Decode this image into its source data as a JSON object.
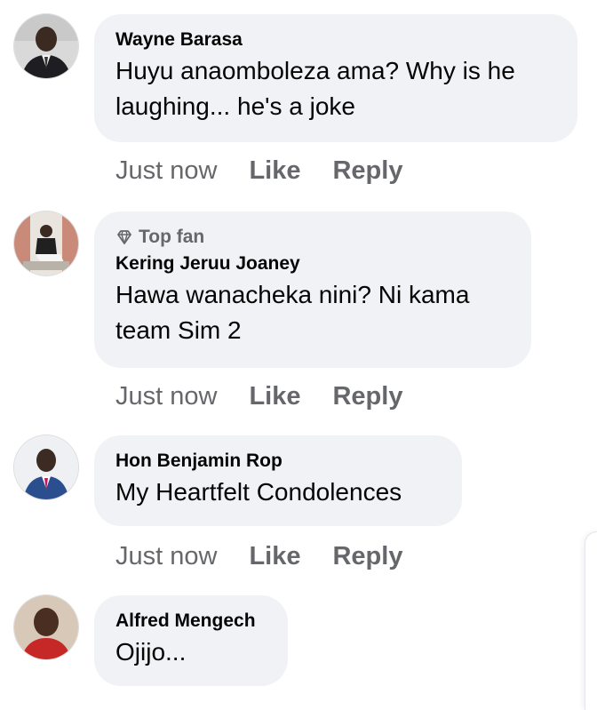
{
  "comments": [
    {
      "author": "Wayne Barasa",
      "badge": "",
      "text_lines": [
        "Huyu anaomboleza ama? Why is he",
        "laughing... he's a joke"
      ],
      "time": "Just now",
      "like_label": "Like",
      "reply_label": "Reply"
    },
    {
      "author": "Kering Jeruu Joaney",
      "badge": "Top fan",
      "badge_icon": "diamond-icon",
      "text_lines": [
        "Hawa wanacheka nini? Ni kama",
        "team Sim 2"
      ],
      "time": "Just now",
      "like_label": "Like",
      "reply_label": "Reply"
    },
    {
      "author": "Hon Benjamin Rop",
      "badge": "",
      "text_lines": [
        "My Heartfelt Condolences"
      ],
      "time": "Just now",
      "like_label": "Like",
      "reply_label": "Reply"
    },
    {
      "author": "Alfred Mengech",
      "badge": "",
      "text_lines": [
        "Ojijo..."
      ],
      "time": "",
      "like_label": "",
      "reply_label": ""
    }
  ],
  "colors": {
    "bubble_bg": "#f0f2f5",
    "secondary_text": "#65676b",
    "primary_text": "#050505"
  }
}
